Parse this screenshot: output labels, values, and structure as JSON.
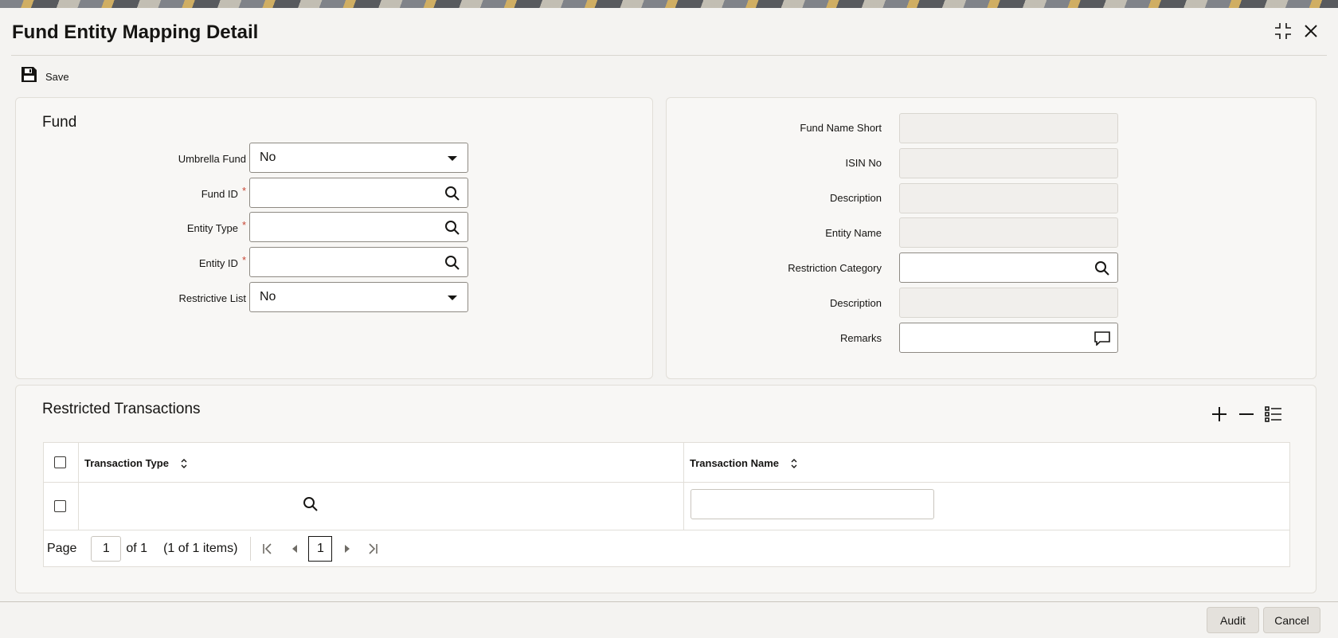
{
  "window": {
    "title": "Fund Entity Mapping Detail",
    "maximize_icon": "maximize-icon",
    "close_icon": "close-icon"
  },
  "toolbar": {
    "save_label": "Save"
  },
  "fund_section": {
    "title": "Fund",
    "umbrella_fund": {
      "label": "Umbrella Fund",
      "value": "No"
    },
    "fund_id": {
      "label": "Fund ID",
      "value": "",
      "required": "*"
    },
    "entity_type": {
      "label": "Entity Type",
      "value": "",
      "required": "*"
    },
    "entity_id": {
      "label": "Entity ID",
      "value": "",
      "required": "*"
    },
    "restrictive_list": {
      "label": "Restrictive List",
      "value": "No"
    }
  },
  "details_section": {
    "fund_name_short": {
      "label": "Fund Name Short",
      "value": ""
    },
    "isin_no": {
      "label": "ISIN No",
      "value": ""
    },
    "description": {
      "label": "Description",
      "value": ""
    },
    "entity_name": {
      "label": "Entity Name",
      "value": ""
    },
    "restriction_category": {
      "label": "Restriction Category",
      "value": ""
    },
    "description2": {
      "label": "Description",
      "value": ""
    },
    "remarks": {
      "label": "Remarks",
      "value": ""
    }
  },
  "restricted_transactions": {
    "title": "Restricted Transactions",
    "columns": [
      "Transaction Type",
      "Transaction Name"
    ],
    "rows": [
      {
        "transaction_type": "",
        "transaction_name": ""
      }
    ],
    "pager": {
      "page_label": "Page",
      "page_value": "1",
      "of_label": "of 1",
      "items_label": "(1 of 1 items)",
      "current_page": "1"
    }
  },
  "footer": {
    "audit_label": "Audit",
    "cancel_label": "Cancel"
  },
  "colors": {
    "required": "#c74634",
    "panel_bg": "#f8f7f5",
    "page_bg": "#f4f3f1"
  }
}
